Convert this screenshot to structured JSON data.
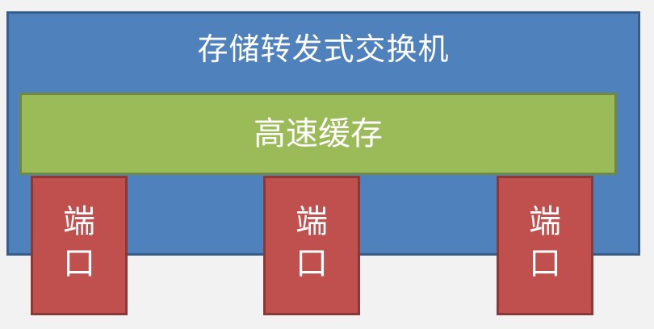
{
  "switch": {
    "title": "存储转发式交换机",
    "color": "#4f81bd"
  },
  "cache": {
    "label": "高速缓存",
    "color": "#9bbb59"
  },
  "ports": [
    {
      "label": "端口",
      "color": "#c0504d"
    },
    {
      "label": "端口",
      "color": "#c0504d"
    },
    {
      "label": "端口",
      "color": "#c0504d"
    }
  ]
}
